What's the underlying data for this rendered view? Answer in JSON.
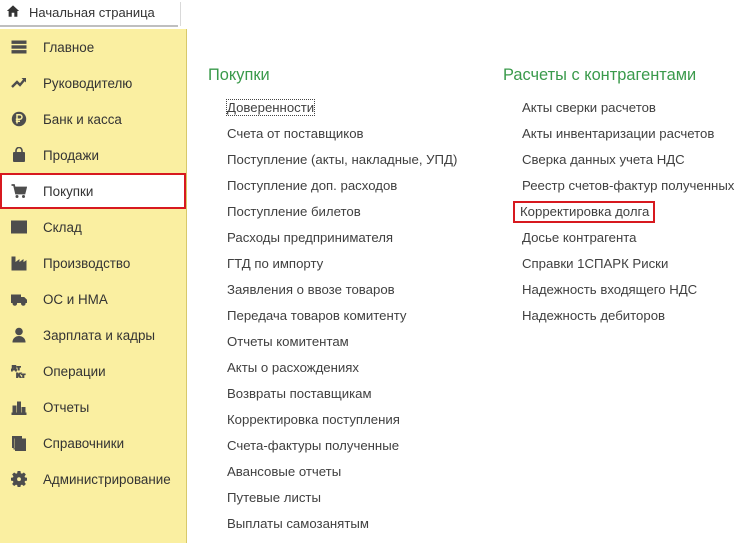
{
  "tabs": {
    "home_label": "Начальная страница"
  },
  "sidebar": {
    "items": [
      {
        "label": "Главное",
        "icon": "menu-icon"
      },
      {
        "label": "Руководителю",
        "icon": "trend-icon"
      },
      {
        "label": "Банк и касса",
        "icon": "ruble-icon"
      },
      {
        "label": "Продажи",
        "icon": "bag-icon"
      },
      {
        "label": "Покупки",
        "icon": "cart-icon",
        "selected": true
      },
      {
        "label": "Склад",
        "icon": "warehouse-icon"
      },
      {
        "label": "Производство",
        "icon": "factory-icon"
      },
      {
        "label": "ОС и НМА",
        "icon": "truck-icon"
      },
      {
        "label": "Зарплата и кадры",
        "icon": "person-icon"
      },
      {
        "label": "Операции",
        "icon": "dt-kt-icon"
      },
      {
        "label": "Отчеты",
        "icon": "bar-chart-icon"
      },
      {
        "label": "Справочники",
        "icon": "books-icon"
      },
      {
        "label": "Администрирование",
        "icon": "gear-icon"
      }
    ],
    "dt_kt_glyph": {
      "top": "Дт",
      "bottom": "Кт"
    }
  },
  "purchases": {
    "title": "Покупки",
    "links": [
      "Доверенности",
      "Счета от поставщиков",
      "Поступление (акты, накладные, УПД)",
      "Поступление доп. расходов",
      "Поступление билетов",
      "Расходы предпринимателя",
      "ГТД по импорту",
      "Заявления о ввозе товаров",
      "Передача товаров комитенту",
      "Отчеты комитентам",
      "Акты о расхождениях",
      "Возвраты поставщикам",
      "Корректировка поступления",
      "Счета-фактуры полученные",
      "Авансовые отчеты",
      "Путевые листы",
      "Выплаты самозанятым"
    ]
  },
  "settlements": {
    "title": "Расчеты с контрагентами",
    "links": [
      "Акты сверки расчетов",
      "Акты инвентаризации расчетов",
      "Сверка данных учета НДС",
      "Реестр счетов-фактур полученных",
      "Корректировка долга",
      "Досье контрагента",
      "Справки 1СПАРК Риски",
      "Надежность входящего НДС",
      "Надежность дебиторов"
    ]
  },
  "colors": {
    "sidebar_bg": "#faefa1",
    "section_title": "#3a9a4b",
    "highlight_border": "#d7191f"
  }
}
